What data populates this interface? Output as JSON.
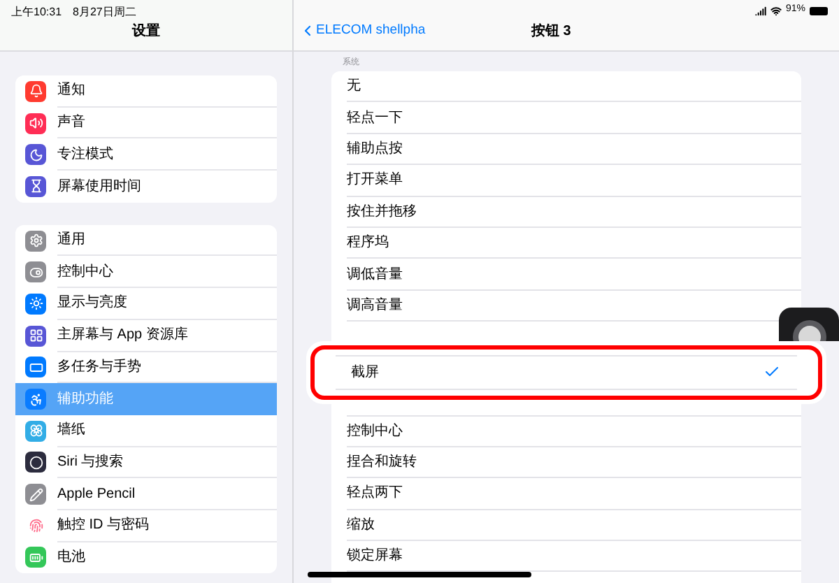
{
  "status_bar": {
    "time": "上午10:31",
    "date": "8月27日周二",
    "battery": "91%"
  },
  "sidebar": {
    "title": "设置",
    "groups": [
      [
        {
          "label": "通知",
          "color": "#ff3b30",
          "selected": false
        },
        {
          "label": "声音",
          "color": "#ff2d55",
          "selected": false
        },
        {
          "label": "专注模式",
          "color": "#5856d6",
          "selected": false
        },
        {
          "label": "屏幕使用时间",
          "color": "#5856d6",
          "selected": false
        }
      ],
      [
        {
          "label": "通用",
          "color": "#8e8e93",
          "selected": false
        },
        {
          "label": "控制中心",
          "color": "#8e8e93",
          "selected": false
        },
        {
          "label": "显示与亮度",
          "color": "#007aff",
          "selected": false
        },
        {
          "label": "主屏幕与 App 资源库",
          "color": "#5856d6",
          "selected": false
        },
        {
          "label": "多任务与手势",
          "color": "#007aff",
          "selected": false
        },
        {
          "label": "辅助功能",
          "color": "#0a7cff",
          "selected": true
        },
        {
          "label": "墙纸",
          "color": "#32ade6",
          "selected": false
        },
        {
          "label": "Siri 与搜索",
          "color": "#2c2c3e",
          "selected": false
        },
        {
          "label": "Apple Pencil",
          "color": "#8e8e93",
          "selected": false
        },
        {
          "label": "触控 ID 与密码",
          "color": "#ffffff",
          "selected": false
        },
        {
          "label": "电池",
          "color": "#34c759",
          "selected": false
        }
      ]
    ]
  },
  "detail": {
    "back": "ELECOM shellpha",
    "title": "按钮 3",
    "section": "系统",
    "options_top": [
      {
        "label": "无",
        "selected": false
      },
      {
        "label": "轻点一下",
        "selected": false
      },
      {
        "label": "辅助点按",
        "selected": false
      },
      {
        "label": "打开菜单",
        "selected": false
      },
      {
        "label": "按住并拖移",
        "selected": false
      },
      {
        "label": "程序坞",
        "selected": false
      },
      {
        "label": "调低音量",
        "selected": false
      },
      {
        "label": "调高音量",
        "selected": false
      }
    ],
    "highlighted": {
      "label": "截屏",
      "selected": true
    },
    "options_bottom": [
      {
        "label": "控制中心",
        "selected": false
      },
      {
        "label": "捏合和旋转",
        "selected": false
      },
      {
        "label": "轻点两下",
        "selected": false
      },
      {
        "label": "缩放",
        "selected": false
      },
      {
        "label": "锁定屏幕",
        "selected": false
      }
    ]
  }
}
